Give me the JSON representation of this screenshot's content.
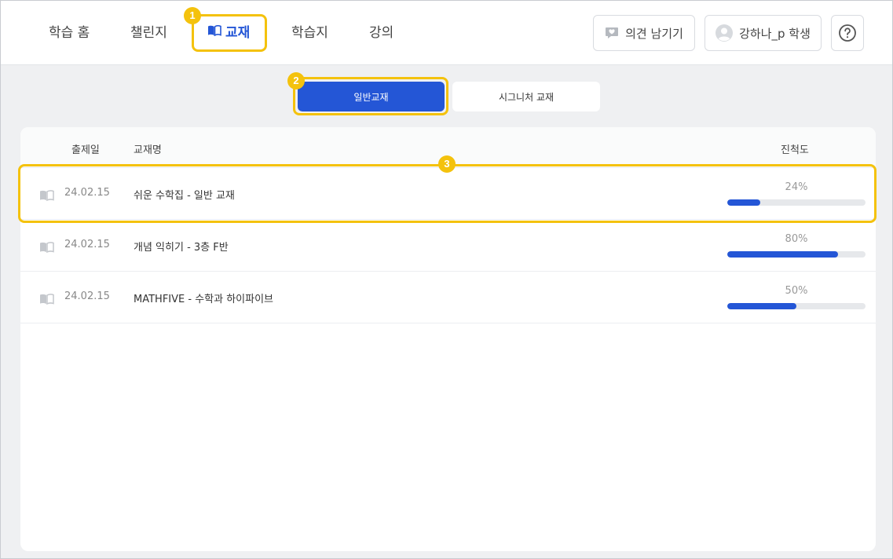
{
  "nav": {
    "items": [
      {
        "label": "학습 홈"
      },
      {
        "label": "챌린지"
      },
      {
        "label": "교재"
      },
      {
        "label": "학습지"
      },
      {
        "label": "강의"
      }
    ],
    "feedback_label": "의견 남기기",
    "user_label": "강하나_p 학생",
    "help_icon": "question-circle-icon"
  },
  "badges": [
    "1",
    "2",
    "3"
  ],
  "tabs": {
    "general": "일반교재",
    "signature": "시그니처 교재"
  },
  "table": {
    "headers": {
      "date": "출제일",
      "name": "교재명",
      "progress": "진척도"
    },
    "rows": [
      {
        "date": "24.02.15",
        "title": "쉬운 수학집 - 일반 교재",
        "progress_label": "24%",
        "progress": 24
      },
      {
        "date": "24.02.15",
        "title": "개념 익히기 - 3층 F반",
        "progress_label": "80%",
        "progress": 80
      },
      {
        "date": "24.02.15",
        "title": "MATHFIVE - 수학과 하이파이브",
        "progress_label": "50%",
        "progress": 50
      }
    ]
  },
  "colors": {
    "accent": "#2456d6",
    "highlight": "#f4c20d",
    "track": "#e6e8eb"
  }
}
